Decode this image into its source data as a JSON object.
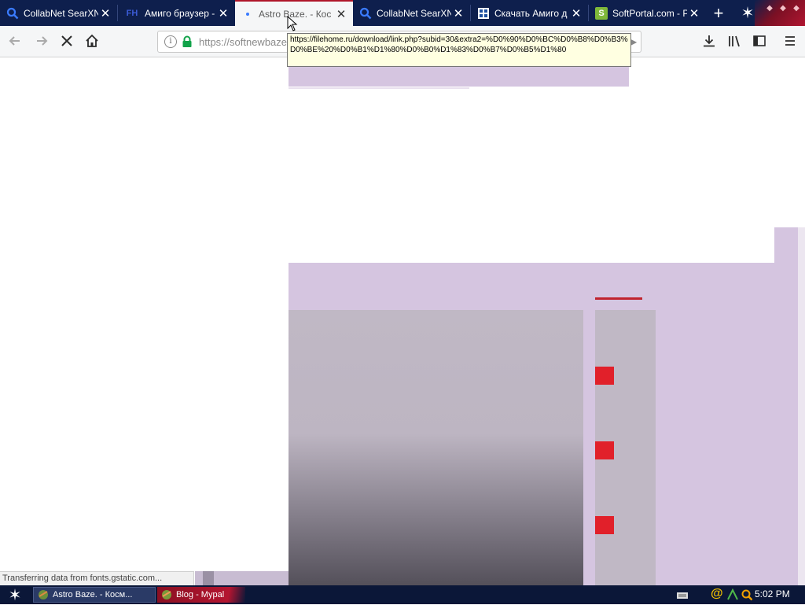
{
  "tabs": [
    {
      "title": "CollabNet SearXNG",
      "icon": "search-icon",
      "active": false
    },
    {
      "title": "Амиго браузер - с",
      "icon": "fh-icon",
      "active": false
    },
    {
      "title": "Astro Baze. - Кос",
      "icon": "loading-dot-icon",
      "active": true
    },
    {
      "title": "CollabNet SearXNG",
      "icon": "search-icon",
      "active": false
    },
    {
      "title": "Скачать Амиго д",
      "icon": "softportal-grid-icon",
      "active": false
    },
    {
      "title": "SoftPortal.com - Р",
      "icon": "s-logo-icon",
      "active": false
    }
  ],
  "tab_icon_text": {
    "fh": "FH",
    "s": "S"
  },
  "address_bar": {
    "url": "https://softnewbaze"
  },
  "tooltip": {
    "text": "https://filehome.ru/download/link.php?subid=30&extra2=%D0%90%D0%BC%D0%B8%D0%B3%D0%BE%20%D0%B1%D1%80%D0%B0%D1%83%D0%B7%D0%B5%D1%80"
  },
  "status_text": "Transferring data from fonts.gstatic.com...",
  "taskbar": {
    "items": [
      {
        "label": "Astro Baze. - Косм...",
        "icon": "browser-icon"
      },
      {
        "label": "Blog - Mypal",
        "icon": "mypal-icon"
      }
    ],
    "clock": "5:02 PM",
    "tray_icons": [
      "keyboard-icon",
      "at-sign-icon",
      "network-icon",
      "search-icon"
    ]
  },
  "colors": {
    "tabbar": "#0e1f4d",
    "accent_red": "#b0162a",
    "page_lavender": "#d5c5e0",
    "page_gray": "#c0b8c5",
    "red_square": "#e1202a"
  }
}
